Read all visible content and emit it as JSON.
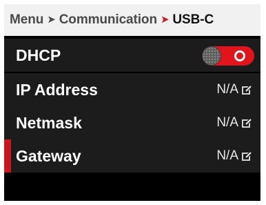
{
  "breadcrumb": {
    "items": [
      "Menu",
      "Communication",
      "USB-C"
    ],
    "separator_icon": "chevron-right-icon"
  },
  "rows": [
    {
      "label": "DHCP",
      "control": "toggle",
      "toggle_state": "on"
    },
    {
      "label": "IP Address",
      "value": "N/A",
      "icon": "edit-icon"
    },
    {
      "label": "Netmask",
      "value": "N/A",
      "icon": "edit-icon"
    },
    {
      "label": "Gateway",
      "value": "N/A",
      "icon": "edit-icon",
      "selected": true
    }
  ],
  "colors": {
    "accent": "#e2141b",
    "selection_bar": "#c8161d",
    "row_background": "#1c1c1c",
    "screen_background": "#000000",
    "breadcrumb_background": "#f1f1f1"
  }
}
